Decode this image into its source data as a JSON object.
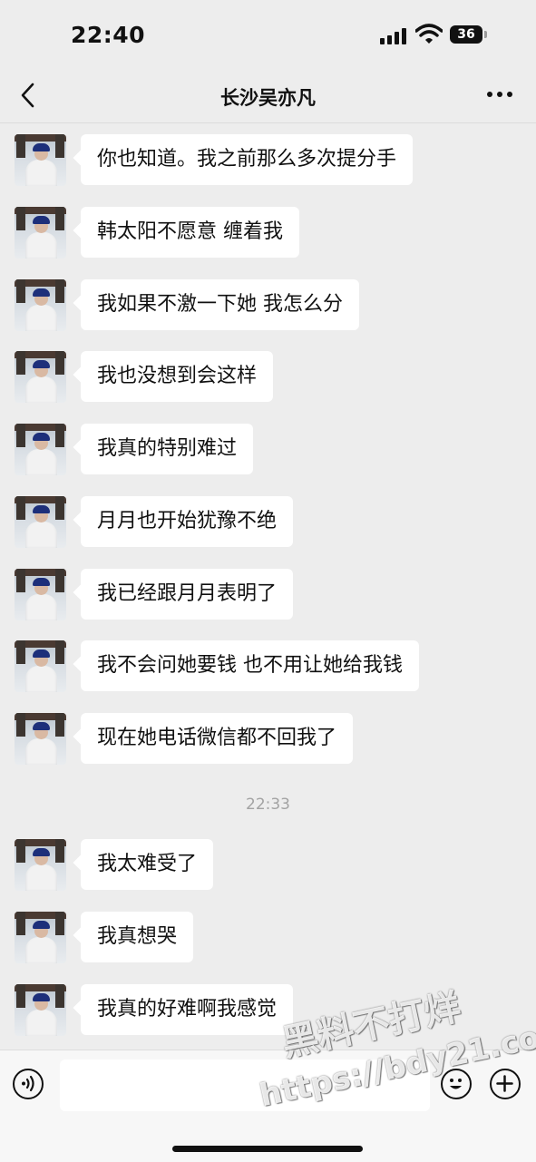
{
  "status_bar": {
    "time": "22:40",
    "battery": "36"
  },
  "header": {
    "title": "长沙吴亦凡"
  },
  "messages": [
    {
      "text": "你也知道。我之前那么多次提分手"
    },
    {
      "text": "韩太阳不愿意 缠着我"
    },
    {
      "text": "我如果不激一下她 我怎么分"
    },
    {
      "text": "我也没想到会这样"
    },
    {
      "text": "我真的特别难过"
    },
    {
      "text": "月月也开始犹豫不绝"
    },
    {
      "text": "我已经跟月月表明了"
    },
    {
      "text": "我不会问她要钱 也不用让她给我钱"
    },
    {
      "text": "现在她电话微信都不回我了"
    },
    {
      "text": "我太难受了"
    },
    {
      "text": "我真想哭"
    },
    {
      "text": "我真的好难啊我感觉"
    }
  ],
  "timestamp": "22:33",
  "input": {
    "value": ""
  },
  "watermark": {
    "line1": "黑料不打烊",
    "line2": "https://bdy21.co"
  },
  "colors": {
    "background": "#ededed",
    "bubble": "#ffffff",
    "timestamp": "#a3a3a3"
  },
  "icons": {
    "back": "chevron-left-icon",
    "more": "more-dots-icon",
    "voice": "voice-icon",
    "emoji": "emoji-icon",
    "plus": "plus-icon"
  }
}
